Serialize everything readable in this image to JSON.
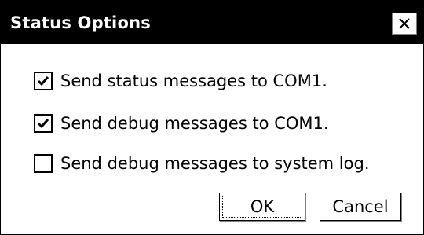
{
  "dialog": {
    "title": "Status Options",
    "close_icon": "close-x-icon"
  },
  "options": [
    {
      "label": "Send status messages to COM1.",
      "checked": true
    },
    {
      "label": "Send debug messages to COM1.",
      "checked": true
    },
    {
      "label": "Send debug messages to system log.",
      "checked": false
    }
  ],
  "buttons": {
    "ok_label": "OK",
    "cancel_label": "Cancel"
  },
  "colors": {
    "titlebar": "#000000",
    "title_text": "#ffffff",
    "background": "#ffffff"
  }
}
